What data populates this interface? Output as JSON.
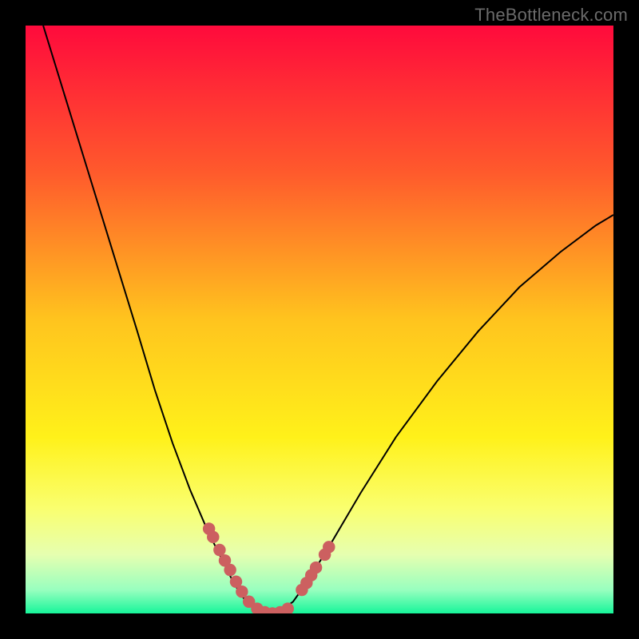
{
  "watermark": "TheBottleneck.com",
  "chart_data": {
    "type": "line",
    "title": "",
    "xlabel": "",
    "ylabel": "",
    "xlim": [
      0,
      1
    ],
    "ylim": [
      0,
      1
    ],
    "background_gradient": {
      "direction": "vertical",
      "stops": [
        {
          "t": 0.0,
          "color": "#ff0a3c"
        },
        {
          "t": 0.25,
          "color": "#ff5a2c"
        },
        {
          "t": 0.5,
          "color": "#ffc41e"
        },
        {
          "t": 0.7,
          "color": "#fff11a"
        },
        {
          "t": 0.82,
          "color": "#faff6e"
        },
        {
          "t": 0.9,
          "color": "#e6ffb0"
        },
        {
          "t": 0.96,
          "color": "#98ffbf"
        },
        {
          "t": 1.0,
          "color": "#17f59a"
        }
      ]
    },
    "series": [
      {
        "name": "curve",
        "points": [
          {
            "x": 0.03,
            "y": 1.0
          },
          {
            "x": 0.07,
            "y": 0.87
          },
          {
            "x": 0.11,
            "y": 0.74
          },
          {
            "x": 0.15,
            "y": 0.61
          },
          {
            "x": 0.19,
            "y": 0.48
          },
          {
            "x": 0.22,
            "y": 0.38
          },
          {
            "x": 0.25,
            "y": 0.29
          },
          {
            "x": 0.28,
            "y": 0.21
          },
          {
            "x": 0.31,
            "y": 0.14
          },
          {
            "x": 0.335,
            "y": 0.09
          },
          {
            "x": 0.355,
            "y": 0.05
          },
          {
            "x": 0.375,
            "y": 0.02
          },
          {
            "x": 0.395,
            "y": 0.005
          },
          {
            "x": 0.415,
            "y": 0.0
          },
          {
            "x": 0.435,
            "y": 0.005
          },
          {
            "x": 0.455,
            "y": 0.02
          },
          {
            "x": 0.48,
            "y": 0.055
          },
          {
            "x": 0.52,
            "y": 0.12
          },
          {
            "x": 0.57,
            "y": 0.205
          },
          {
            "x": 0.63,
            "y": 0.3
          },
          {
            "x": 0.7,
            "y": 0.395
          },
          {
            "x": 0.77,
            "y": 0.48
          },
          {
            "x": 0.84,
            "y": 0.555
          },
          {
            "x": 0.91,
            "y": 0.615
          },
          {
            "x": 0.97,
            "y": 0.66
          },
          {
            "x": 1.0,
            "y": 0.678
          }
        ]
      }
    ],
    "markers": [
      {
        "name": "points-left",
        "positions": [
          {
            "x": 0.312,
            "y": 0.144
          },
          {
            "x": 0.319,
            "y": 0.13
          },
          {
            "x": 0.33,
            "y": 0.108
          },
          {
            "x": 0.339,
            "y": 0.09
          },
          {
            "x": 0.348,
            "y": 0.074
          },
          {
            "x": 0.358,
            "y": 0.054
          },
          {
            "x": 0.368,
            "y": 0.037
          },
          {
            "x": 0.38,
            "y": 0.02
          },
          {
            "x": 0.394,
            "y": 0.008
          },
          {
            "x": 0.407,
            "y": 0.002
          },
          {
            "x": 0.42,
            "y": 0.0
          },
          {
            "x": 0.433,
            "y": 0.002
          },
          {
            "x": 0.446,
            "y": 0.008
          }
        ]
      },
      {
        "name": "points-right",
        "positions": [
          {
            "x": 0.47,
            "y": 0.04
          },
          {
            "x": 0.478,
            "y": 0.052
          },
          {
            "x": 0.486,
            "y": 0.065
          },
          {
            "x": 0.494,
            "y": 0.078
          },
          {
            "x": 0.509,
            "y": 0.1
          },
          {
            "x": 0.516,
            "y": 0.113
          }
        ]
      }
    ],
    "marker_style": {
      "color": "#cc6060",
      "size_frac": 0.021
    }
  }
}
